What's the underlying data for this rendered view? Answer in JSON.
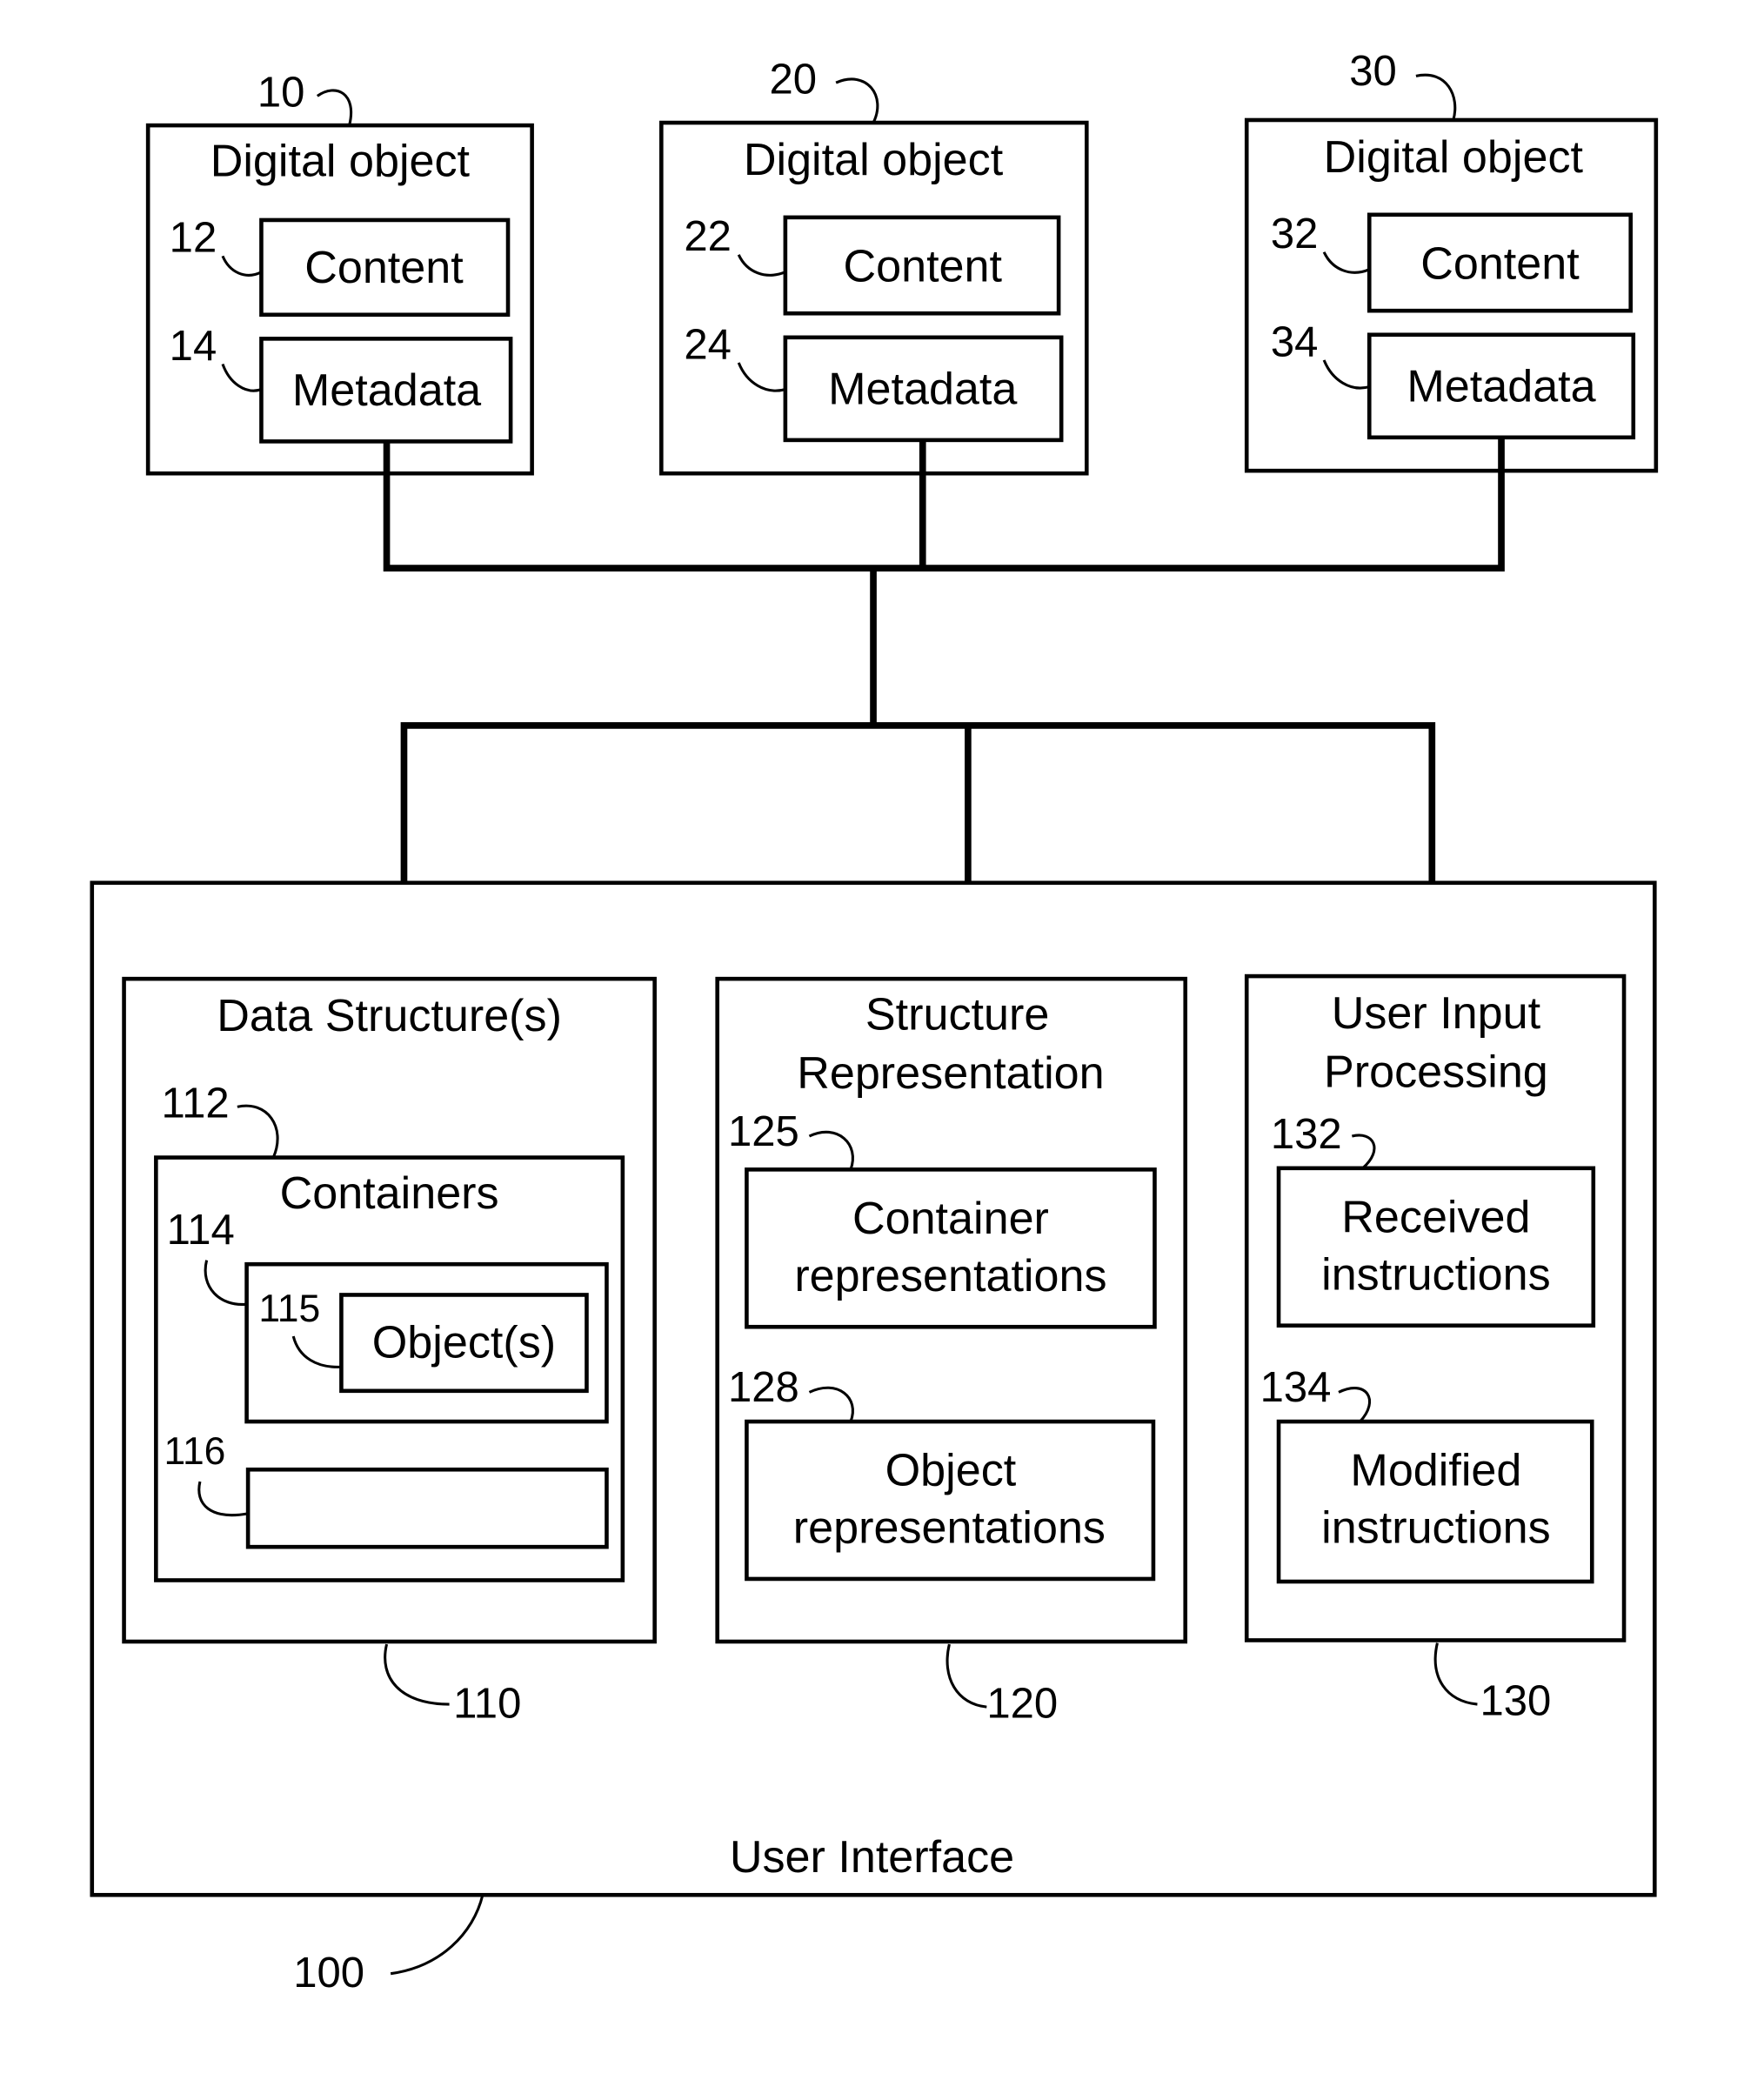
{
  "digital_objects": [
    {
      "ref": "10",
      "title": "Digital object",
      "content_ref": "12",
      "content": "Content",
      "metadata_ref": "14",
      "metadata": "Metadata"
    },
    {
      "ref": "20",
      "title": "Digital object",
      "content_ref": "22",
      "content": "Content",
      "metadata_ref": "24",
      "metadata": "Metadata"
    },
    {
      "ref": "30",
      "title": "Digital object",
      "content_ref": "32",
      "content": "Content",
      "metadata_ref": "34",
      "metadata": "Metadata"
    }
  ],
  "user_interface": {
    "ref": "100",
    "label": "User Interface",
    "data_structures": {
      "ref": "110",
      "title": "Data Structure(s)",
      "containers": {
        "ref": "112",
        "title": "Containers",
        "container_ref": "114",
        "objects_ref": "115",
        "objects": "Object(s)",
        "empty_container_ref": "116"
      }
    },
    "structure_representation": {
      "ref": "120",
      "title_line1": "Structure",
      "title_line2": "Representation",
      "container_repr_ref": "125",
      "container_repr_line1": "Container",
      "container_repr_line2": "representations",
      "object_repr_ref": "128",
      "object_repr_line1": "Object",
      "object_repr_line2": "representations"
    },
    "user_input_processing": {
      "ref": "130",
      "title_line1": "User Input",
      "title_line2": "Processing",
      "received_ref": "132",
      "received_line1": "Received",
      "received_line2": "instructions",
      "modified_ref": "134",
      "modified_line1": "Modified",
      "modified_line2": "instructions"
    }
  }
}
